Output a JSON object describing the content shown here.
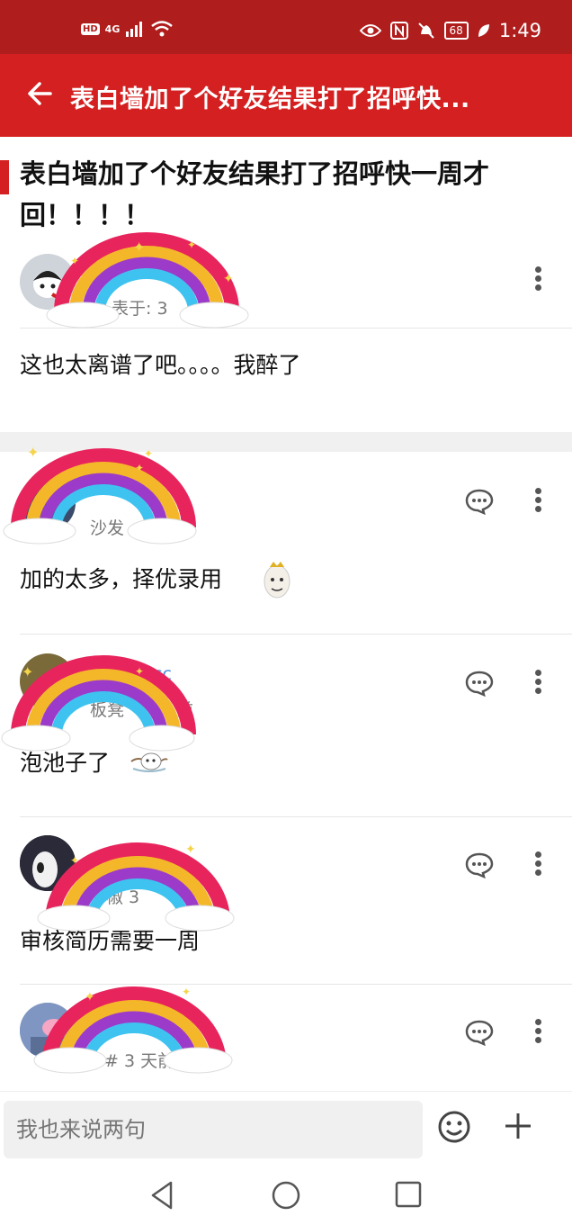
{
  "status_bar": {
    "hd_badge": "HD",
    "network": "4G",
    "battery": "68",
    "time": "1:49",
    "icons": [
      "signal-icon",
      "wifi-icon",
      "eye-icon",
      "nfc-icon",
      "mute-icon",
      "battery-icon",
      "leaf-icon"
    ]
  },
  "app_bar": {
    "title": "表白墙加了个好友结果打了招呼快...",
    "back_icon": "arrow-left-icon"
  },
  "post": {
    "title": "表白墙加了个好友结果打了招呼快一周才回！！！！",
    "author_meta": "表于: 3",
    "content": "这也太离谱了吧。。。。我醉了"
  },
  "comments": [
    {
      "username": "",
      "meta": "沙发",
      "content": "加的太多，择优录用"
    },
    {
      "username": "cc",
      "meta": "板凳",
      "meta_suffix": "前",
      "content": "泡池子了"
    },
    {
      "username": "",
      "meta": "椒 3",
      "content": "审核简历需要一周"
    },
    {
      "username": "",
      "meta": "# 3 天前",
      "content": ""
    }
  ],
  "bottom_bar": {
    "input_placeholder": "我也来说两句"
  },
  "colors": {
    "status_bar": "#b01d1d",
    "app_bar": "#d42020",
    "accent": "#d42020",
    "link": "#4a8fd6"
  }
}
